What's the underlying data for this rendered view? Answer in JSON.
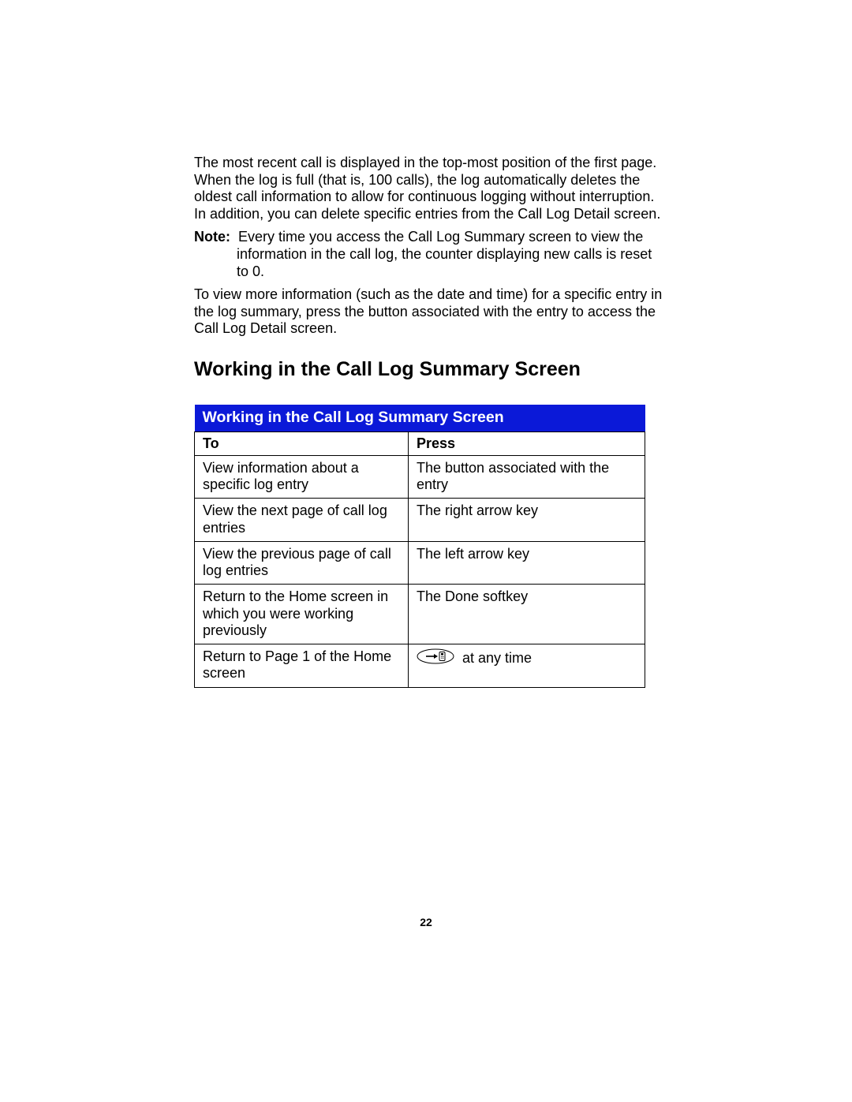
{
  "intro": {
    "p1": "The most recent call is displayed in the top-most position of the first page. When the log is full (that is, 100 calls), the log automatically deletes the oldest call information to allow for continuous logging without interruption. In addition, you can delete specific entries from the Call Log Detail screen.",
    "note_label": "Note:",
    "note_line1": "Every time you access the Call Log Summary screen to view the",
    "note_line2": "information in the call log, the counter displaying new calls is reset to 0.",
    "p2": "To view more information (such as the date and time) for a specific entry in the log summary, press the button associated with the entry to access the Call Log Detail screen."
  },
  "section_heading": "Working in the Call Log Summary Screen",
  "table": {
    "title": "Working in the Call Log Summary Screen",
    "headers": {
      "to": "To",
      "press": "Press"
    },
    "rows": [
      {
        "to": "View information about a specific log entry",
        "press": "The button associated with the entry"
      },
      {
        "to": "View the next page of call log entries",
        "press": "The right arrow key"
      },
      {
        "to": "View the previous page of call log entries",
        "press": "The left arrow key"
      },
      {
        "to": "Return to the Home screen in which you were working previously",
        "press": "The Done softkey"
      },
      {
        "to": "Return to Page 1 of the Home screen",
        "press": "at any time",
        "icon": "phone-exit-icon"
      }
    ]
  },
  "page_number": "22"
}
